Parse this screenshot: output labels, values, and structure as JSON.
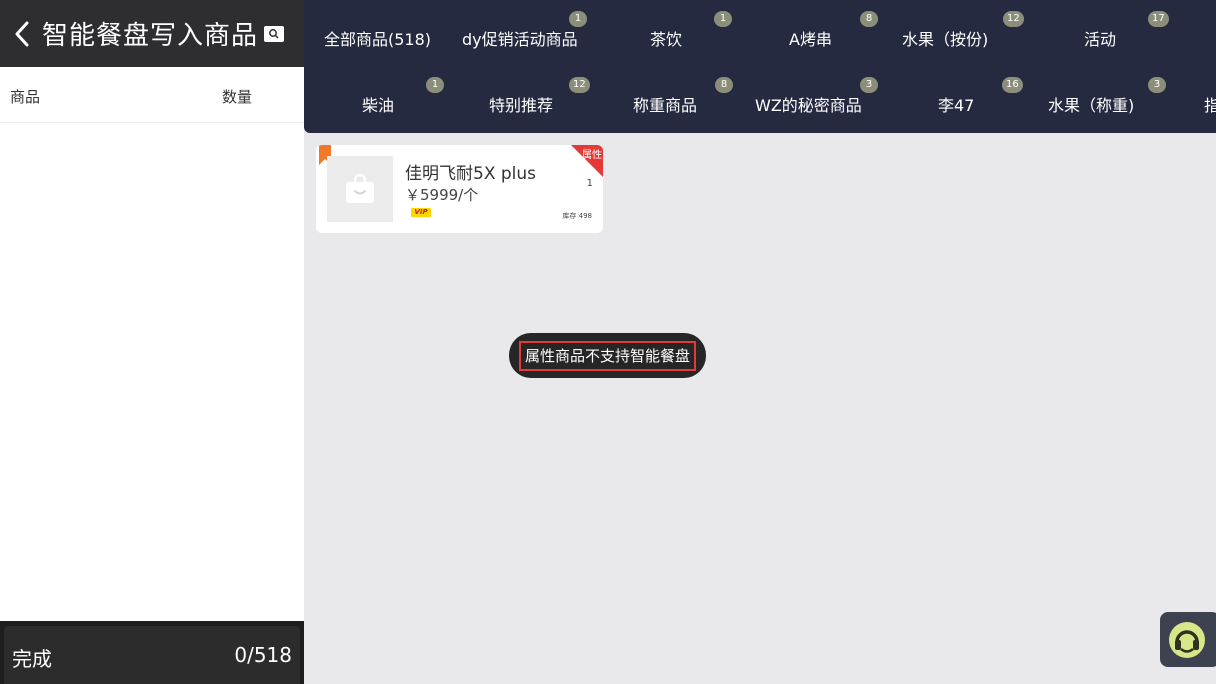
{
  "header": {
    "title": "智能餐盘写入商品"
  },
  "table_header": {
    "goods": "商品",
    "quantity": "数量"
  },
  "footer": {
    "done_label": "完成",
    "count": "0/518"
  },
  "categories": [
    {
      "label": "全部商品(518)",
      "badge": ""
    },
    {
      "label": "dy促销活动商品",
      "badge": "1"
    },
    {
      "label": "茶饮",
      "badge": "1"
    },
    {
      "label": "A烤串",
      "badge": "8"
    },
    {
      "label": "水果（按份)",
      "badge": "12"
    },
    {
      "label": "活动",
      "badge": "17"
    },
    {
      "label": "柴油",
      "badge": "1"
    },
    {
      "label": "特别推荐",
      "badge": "12"
    },
    {
      "label": "称重商品",
      "badge": "8"
    },
    {
      "label": "WZ的秘密商品",
      "badge": "3"
    },
    {
      "label": "李47",
      "badge": "16"
    },
    {
      "label": "水果（称重)",
      "badge": "3"
    },
    {
      "label": "指",
      "badge": ""
    }
  ],
  "product": {
    "name": "佳明飞耐5X plus",
    "price": "￥5999/个",
    "vip": "VIP",
    "attribute_tag": "属性",
    "quantity": "1",
    "stock": "库存 498"
  },
  "toast": {
    "message": "属性商品不支持智能餐盘"
  },
  "colors": {
    "category_bar": "#252a40",
    "header_dark": "#2e2e30",
    "badge": "#8b8f7a",
    "corner_tag": "#e53935",
    "bookmark": "#f07a2a",
    "vip": "#ffd600",
    "support_icon": "#d8e68a"
  }
}
